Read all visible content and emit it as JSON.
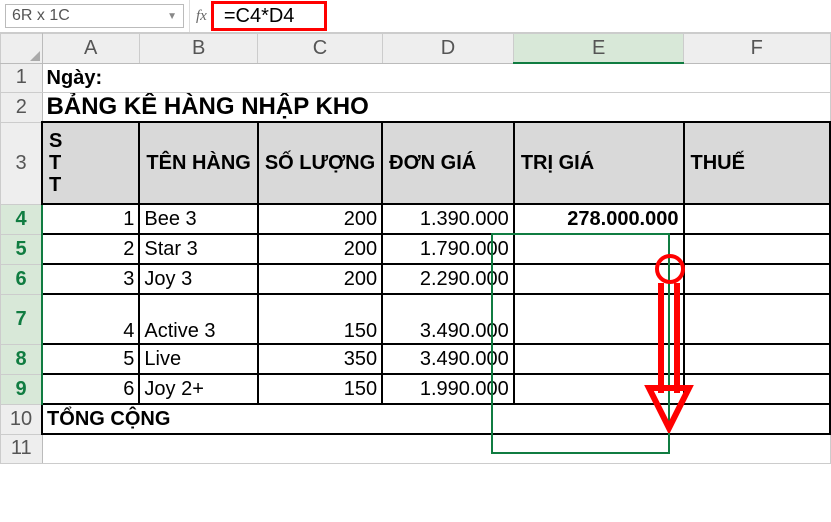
{
  "formula_bar": {
    "name_box": "6R x 1C",
    "fx": "fx",
    "formula": "=C4*D4"
  },
  "columns": [
    "A",
    "B",
    "C",
    "D",
    "E",
    "F"
  ],
  "rows": [
    "1",
    "2",
    "3",
    "4",
    "5",
    "6",
    "7",
    "8",
    "9",
    "10",
    "11"
  ],
  "labels": {
    "ngay": "Ngày:",
    "title": "BẢNG KÊ HÀNG NHẬP KHO",
    "stt": "S\nT\nT",
    "ten_hang": "TÊN HÀNG",
    "so_luong": "SỐ LƯỢNG",
    "don_gia": "ĐƠN GIÁ",
    "tri_gia": "TRỊ GIÁ",
    "thue": "THUẾ",
    "tong_cong": "TỔNG CỘNG"
  },
  "data_rows": [
    {
      "stt": "1",
      "ten": "Bee 3",
      "sl": "200",
      "dg": "1.390.000",
      "tg": "278.000.000"
    },
    {
      "stt": "2",
      "ten": "Star 3",
      "sl": "200",
      "dg": "1.790.000",
      "tg": ""
    },
    {
      "stt": "3",
      "ten": "Joy 3",
      "sl": "200",
      "dg": "2.290.000",
      "tg": ""
    },
    {
      "stt": "4",
      "ten": "Active 3",
      "sl": "150",
      "dg": "3.490.000",
      "tg": ""
    },
    {
      "stt": "5",
      "ten": "Live",
      "sl": "350",
      "dg": "3.490.000",
      "tg": ""
    },
    {
      "stt": "6",
      "ten": "Joy 2+",
      "sl": "150",
      "dg": "1.990.000",
      "tg": ""
    }
  ],
  "chart_data": {
    "type": "table",
    "title": "BẢNG KÊ HÀNG NHẬP KHO",
    "columns": [
      "STT",
      "TÊN HÀNG",
      "SỐ LƯỢNG",
      "ĐƠN GIÁ",
      "TRỊ GIÁ",
      "THUẾ"
    ],
    "rows": [
      [
        1,
        "Bee 3",
        200,
        1390000,
        278000000,
        null
      ],
      [
        2,
        "Star 3",
        200,
        1790000,
        null,
        null
      ],
      [
        3,
        "Joy 3",
        200,
        2290000,
        null,
        null
      ],
      [
        4,
        "Active 3",
        150,
        3490000,
        null,
        null
      ],
      [
        5,
        "Live",
        350,
        3490000,
        null,
        null
      ],
      [
        6,
        "Joy 2+",
        150,
        1990000,
        null,
        null
      ]
    ],
    "formula_E4": "=C4*D4"
  }
}
